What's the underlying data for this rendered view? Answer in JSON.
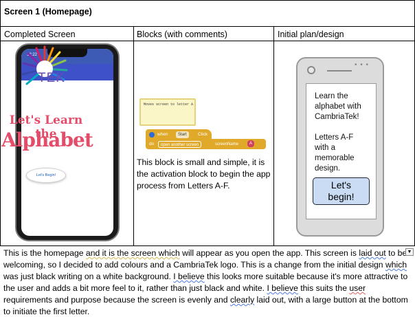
{
  "document": {
    "title": "Screen 1 (Homepage)",
    "columns": [
      "Completed Screen",
      "Blocks (with comments)",
      "Initial plan/design"
    ]
  },
  "phone_app": {
    "time": "12:22",
    "screen_title": "Screen1",
    "logo_text": "TEK",
    "headline_1": "Let's Learn the",
    "headline_2": "Alphabet",
    "button_label": "Let's Begin!"
  },
  "blocks": {
    "comment": "Moves screen to letter A",
    "when_label": "when",
    "start_component": "Start",
    "event": "Click",
    "do_label": "do",
    "action": "open another screen",
    "param": "screenName",
    "value": "A",
    "caption": "This block is small and simple, it is the activation block to begin the app process from Letters A-F."
  },
  "sketch": {
    "line1": "Learn the",
    "line2": "alphabet with",
    "line3": "CambriaTek!",
    "line4": "Letters A-F",
    "line5": "with a",
    "line6": "memorable",
    "line7": "design.",
    "button_line1": "Let's",
    "button_line2": "begin!"
  },
  "paragraph": {
    "s1": "This is the homepage ",
    "s2": "and it is the screen which",
    "s3": " will appear as you open the app. This screen is ",
    "s4": "laid out",
    "s5": " to be welcoming, so I decided to add colours and a CambriaTek logo. This is a change from the initial design ",
    "s6": "which",
    "s7": " was just black writing on a white background. ",
    "s8": "I believe",
    "s9": " this looks more suitable because it's more attractive to the user and adds a bit more feel to it, rather than just black and white. ",
    "s10": "I believe",
    "s11": " this suits the ",
    "s12": "user",
    "s13": " requirements and purpose because the screen is evenly and ",
    "s14": "clearly",
    "s15": " laid out, with a large button at the bottom to initiate the first letter."
  },
  "colors": {
    "app_bar": "#3f51c8",
    "headline": "#e34d6a",
    "block": "#e0a92a",
    "sketch_button": "#c9dcf3"
  }
}
